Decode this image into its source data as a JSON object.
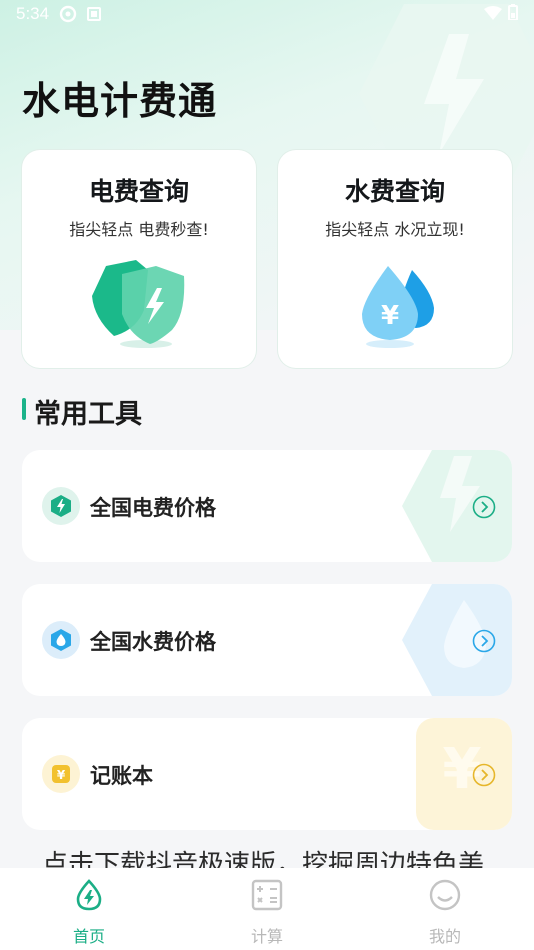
{
  "status_bar": {
    "time": "5:34"
  },
  "app_title": "水电计费通",
  "cards": [
    {
      "title": "电费查询",
      "subtitle": "指尖轻点 电费秒查!",
      "icon": "lightning-shield-icon"
    },
    {
      "title": "水费查询",
      "subtitle": "指尖轻点 水况立现!",
      "icon": "yuan-water-drop-icon"
    }
  ],
  "section_title": "常用工具",
  "tools": [
    {
      "label": "全国电费价格",
      "icon": "lightning-hexagon-icon",
      "accent": "#1bae86"
    },
    {
      "label": "全国水费价格",
      "icon": "water-hexagon-icon",
      "accent": "#2aa7e8"
    },
    {
      "label": "记账本",
      "icon": "yuan-note-icon",
      "accent": "#f2c12e"
    }
  ],
  "marquee_text": "点击下载抖音极速版，挖掘周边特色美",
  "tabbar": {
    "items": [
      {
        "label": "首页",
        "icon": "home-lightning-icon",
        "active": true
      },
      {
        "label": "计算",
        "icon": "calculator-icon",
        "active": false
      },
      {
        "label": "我的",
        "icon": "smile-face-icon",
        "active": false
      }
    ]
  },
  "colors": {
    "accent": "#1bae86",
    "water": "#2aa7e8",
    "note": "#f2c12e",
    "background": "#f5f6f8"
  }
}
